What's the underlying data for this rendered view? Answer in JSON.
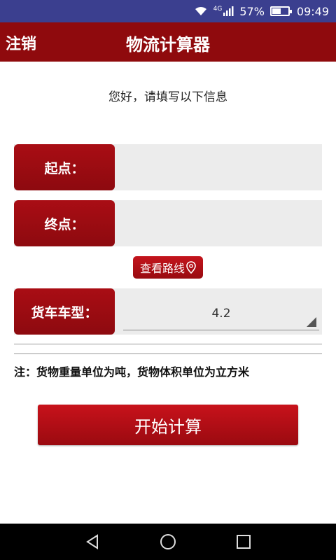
{
  "status_bar": {
    "network": "4G",
    "battery_percent_text": "57%",
    "battery_level": 0.57,
    "time": "09:49"
  },
  "header": {
    "logout_label": "注销",
    "title": "物流计算器"
  },
  "greeting": "您好，请填写以下信息",
  "form": {
    "origin_label": "起点：",
    "origin_value": "",
    "destination_label": "终点：",
    "destination_value": "",
    "route_button_label": "查看路线",
    "truck_type_label": "货车车型：",
    "truck_type_value": "4.2"
  },
  "note": "注：货物重量单位为吨，货物体积单位为立方米",
  "start_button_label": "开始计算",
  "colors": {
    "status_bar": "#3b3f8f",
    "header": "#8f0a0d",
    "accent_red": "#b30f16",
    "field_bg": "#ececec"
  }
}
